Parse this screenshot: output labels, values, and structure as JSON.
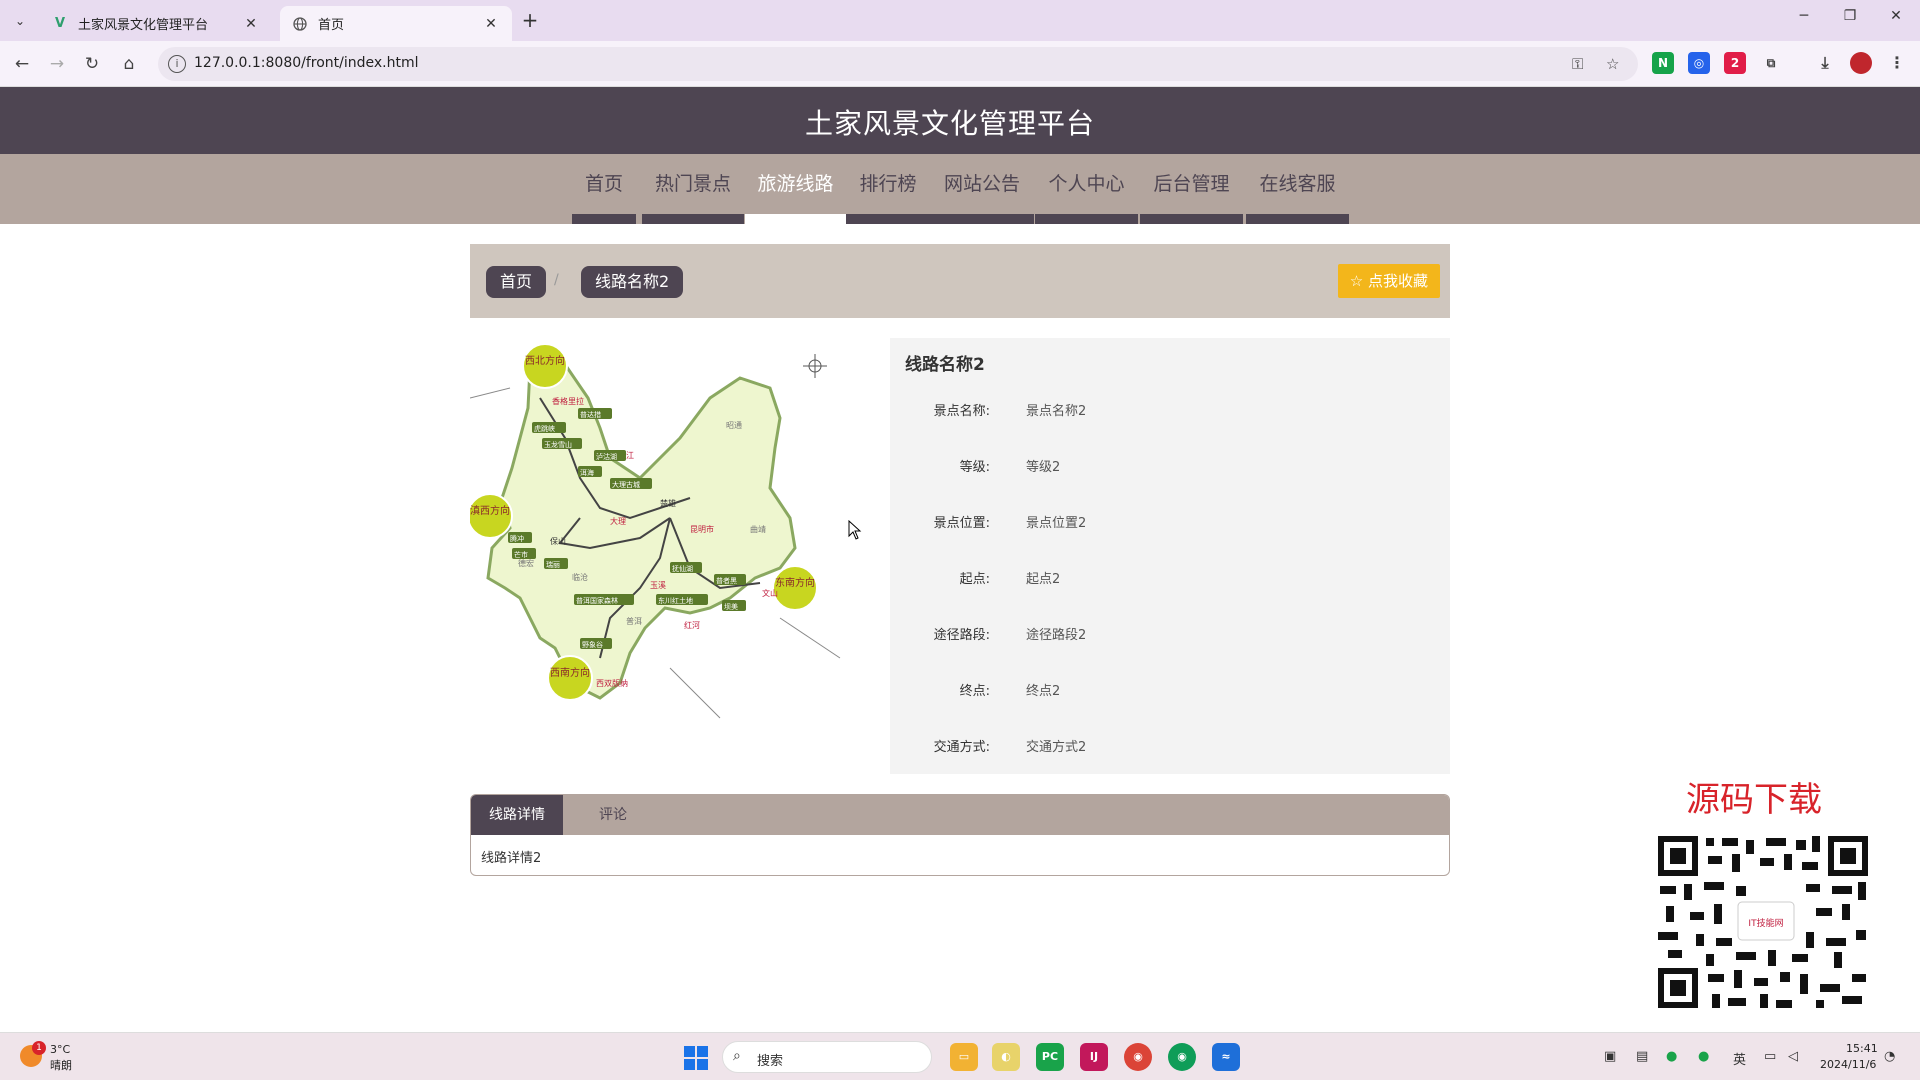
{
  "browser": {
    "tabs": [
      {
        "title": "土家风景文化管理平台",
        "active": false
      },
      {
        "title": "首页",
        "active": true
      }
    ],
    "url": "127.0.0.1:8080/front/index.html"
  },
  "site": {
    "title": "土家风景文化管理平台",
    "nav": [
      "首页",
      "热门景点",
      "旅游线路",
      "排行榜",
      "网站公告",
      "个人中心",
      "后台管理",
      "在线客服"
    ],
    "active_nav": "旅游线路"
  },
  "breadcrumb": {
    "home": "首页",
    "separator": "/",
    "current": "线路名称2",
    "favorite_button": "☆ 点我收藏"
  },
  "detail": {
    "title": "线路名称2",
    "fields": [
      {
        "label": "景点名称:",
        "value": "景点名称2"
      },
      {
        "label": "等级:",
        "value": "等级2"
      },
      {
        "label": "景点位置:",
        "value": "景点位置2"
      },
      {
        "label": "起点:",
        "value": "起点2"
      },
      {
        "label": "途径路段:",
        "value": "途径路段2"
      },
      {
        "label": "终点:",
        "value": "终点2"
      },
      {
        "label": "交通方式:",
        "value": "交通方式2"
      }
    ]
  },
  "map": {
    "regions": [
      "西北方向",
      "滇西方向",
      "东南方向",
      "西南方向"
    ],
    "cities": [
      "香格里拉",
      "丽江",
      "大理",
      "保山",
      "楚雄",
      "昆明市",
      "玉溪",
      "红河",
      "文山",
      "普洱",
      "西双版纳",
      "曲靖",
      "昭通",
      "临沧",
      "德宏"
    ],
    "places": [
      "普达措",
      "虎跳峡",
      "玉龙雪山",
      "泸沽湖",
      "洱海",
      "大理古城",
      "腾冲",
      "芒市",
      "瑞丽",
      "抚仙湖",
      "普者黑",
      "坝美",
      "东川红土地",
      "普洱国家森林",
      "野象谷"
    ]
  },
  "detail_tabs": {
    "tabs": [
      "线路详情",
      "评论"
    ],
    "active": "线路详情",
    "content": "线路详情2"
  },
  "promo": {
    "text": "源码下载",
    "qr_label": "IT技能网"
  },
  "taskbar": {
    "weather_temp": "3°C",
    "weather_desc": "晴朗",
    "weather_badge": "1",
    "search_placeholder": "搜索",
    "ime": "英",
    "time": "15:41",
    "date": "2024/11/6"
  },
  "colors": {
    "header": "#4e4552",
    "nav": "#b3a59e",
    "breadcrumb_bg": "#cfc6be",
    "favorite": "#f3b61b",
    "promo_red": "#d8232a"
  }
}
